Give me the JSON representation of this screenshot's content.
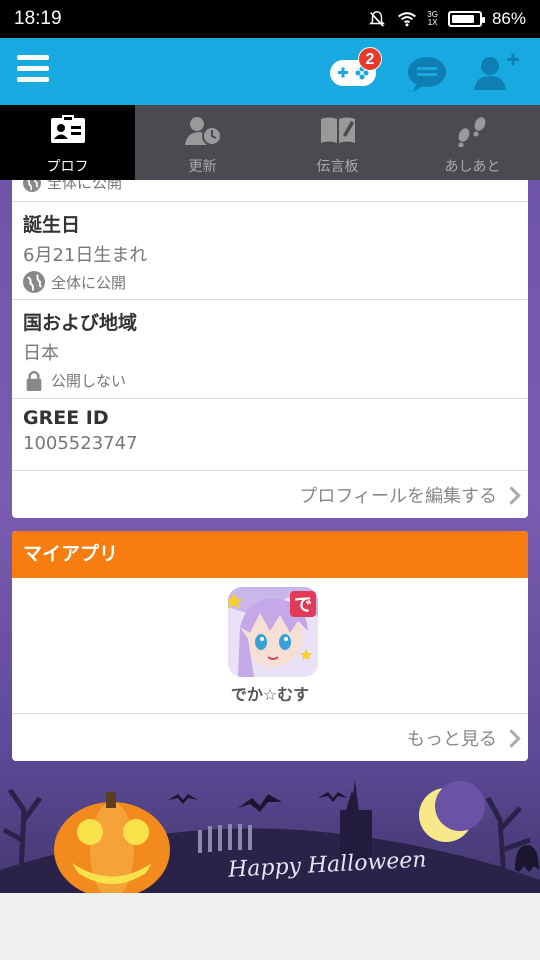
{
  "status": {
    "time": "18:19",
    "network": "3G",
    "network_sub": "1X",
    "battery": "86%",
    "battery_level": 0.86
  },
  "appbar": {
    "badge_count": "2",
    "icons": [
      "menu-icon",
      "game-controller-icon",
      "chat-icon",
      "add-user-icon"
    ]
  },
  "tabs": [
    {
      "label": "プロフ",
      "icon": "profile-card-icon",
      "active": true
    },
    {
      "label": "更新",
      "icon": "update-clock-icon",
      "active": false
    },
    {
      "label": "伝言板",
      "icon": "message-board-icon",
      "active": false
    },
    {
      "label": "あしあと",
      "icon": "footprints-icon",
      "active": false
    }
  ],
  "profile": {
    "partial_visibility": "全体に公開",
    "birthday": {
      "title": "誕生日",
      "value": "6月21日生まれ",
      "visibility": "全体に公開"
    },
    "region": {
      "title": "国および地域",
      "value": "日本",
      "visibility": "公開しない"
    },
    "gree_id": {
      "title": "GREE ID",
      "value": "1005523747"
    },
    "edit_link": "プロフィールを編集する"
  },
  "my_apps": {
    "title": "マイアプリ",
    "apps": [
      {
        "name": "でか☆むす"
      }
    ],
    "more_link": "もっと見る"
  },
  "banner": {
    "text": "Happy Halloween"
  },
  "colors": {
    "appbar": "#18a9e1",
    "tabbar": "#4a4b51",
    "apps_header": "#f77d10",
    "badge": "#e63a2b"
  }
}
